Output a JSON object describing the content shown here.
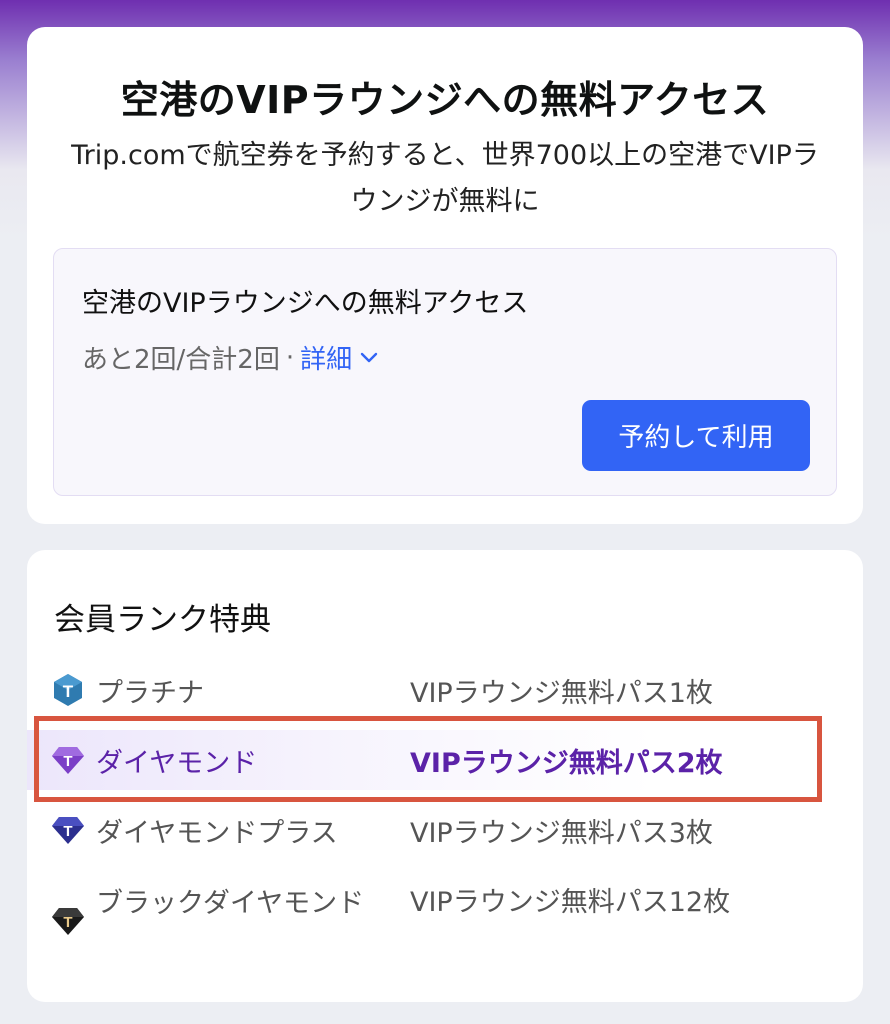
{
  "promo": {
    "title": "空港のVIPラウンジへの無料アクセス",
    "subtitle": "Trip.comで航空券を予約すると、世界700以上の空港でVIPラウンジが無料に"
  },
  "benefit": {
    "title": "空港のVIPラウンジへの無料アクセス",
    "remaining": "あと2回/合計2回",
    "separator": "·",
    "details_label": "詳細",
    "book_button_label": "予約して利用"
  },
  "membership": {
    "section_title": "会員ランク特典",
    "tiers": [
      {
        "name": "プラチナ",
        "benefit": "VIPラウンジ無料パス1枚",
        "icon": "platinum-badge-icon",
        "color": "#2f7bb0"
      },
      {
        "name": "ダイヤモンド",
        "benefit": "VIPラウンジ無料パス2枚",
        "icon": "diamond-badge-icon",
        "color": "#7b3fc7",
        "current": true
      },
      {
        "name": "ダイヤモンドプラス",
        "benefit": "VIPラウンジ無料パス3枚",
        "icon": "diamond-plus-badge-icon",
        "color": "#2c2f8f"
      },
      {
        "name": "ブラックダイヤモンド",
        "benefit": "VIPラウンジ無料パス12枚",
        "icon": "black-diamond-badge-icon",
        "color": "#1a1a1a"
      }
    ]
  },
  "colors": {
    "primary_blue": "#3264f5",
    "diamond_purple": "#5b22a8",
    "highlight_red": "#d8553f"
  }
}
